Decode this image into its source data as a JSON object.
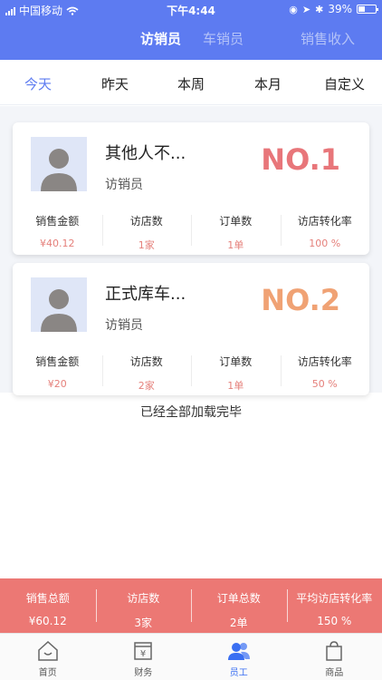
{
  "status_bar": {
    "carrier": "中国移动",
    "time": "下午4:44",
    "battery": "39%"
  },
  "header": {
    "tabs": [
      {
        "label": "访销员",
        "active": true
      },
      {
        "label": "车销员",
        "active": false
      },
      {
        "label": "销售收入",
        "active": false
      }
    ],
    "accent_color": "#5d7bf1"
  },
  "periods": [
    "今天",
    "昨天",
    "本周",
    "本月",
    "自定义"
  ],
  "active_period": "今天",
  "stat_labels": [
    "销售金额",
    "访店数",
    "订单数",
    "访店转化率"
  ],
  "ranking": [
    {
      "name": "其他人不...",
      "role": "访销员",
      "rank": "NO.1",
      "rank_color": "#e8767a",
      "sales": "¥40.12",
      "visits": "1家",
      "orders": "1单",
      "conversion": "100 %"
    },
    {
      "name": "正式库车...",
      "role": "访销员",
      "rank": "NO.2",
      "rank_color": "#f0a274",
      "sales": "¥20",
      "visits": "2家",
      "orders": "1单",
      "conversion": "50 %"
    }
  ],
  "end_text": "已经全部加载完毕",
  "summary": {
    "total_sales_label": "销售总额",
    "total_sales": "¥60.12",
    "visits_label": "访店数",
    "visits": "3家",
    "orders_label": "订单总数",
    "orders": "2单",
    "avg_conversion_label": "平均访店转化率",
    "avg_conversion": "150 %",
    "color": "#ec7874"
  },
  "bottom_nav": [
    {
      "label": "首页",
      "icon": "home-icon",
      "active": false
    },
    {
      "label": "财务",
      "icon": "finance-icon",
      "active": false
    },
    {
      "label": "员工",
      "icon": "staff-icon",
      "active": true
    },
    {
      "label": "商品",
      "icon": "goods-icon",
      "active": false
    }
  ]
}
